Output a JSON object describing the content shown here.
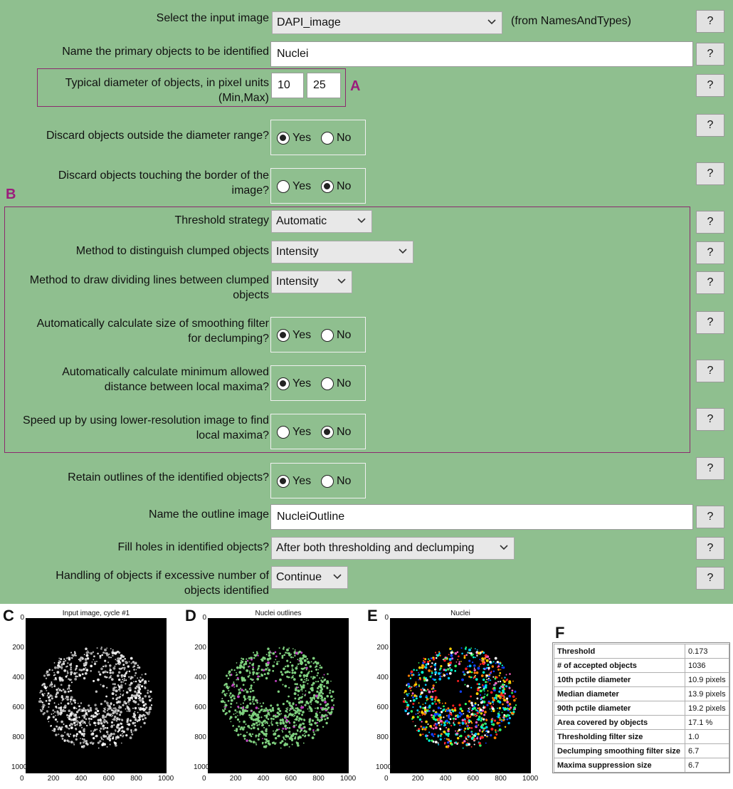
{
  "settings": {
    "input_image": {
      "label": "Select the input image",
      "value": "DAPI_image",
      "note": "(from NamesAndTypes)"
    },
    "primary_objects": {
      "label": "Name the primary objects to be identified",
      "value": "Nuclei"
    },
    "diameter": {
      "label_line1": "Typical diameter of objects, in pixel units",
      "label_line2": "(Min,Max)",
      "min": "10",
      "max": "25"
    },
    "discard_outside": {
      "label": "Discard objects outside the diameter range?"
    },
    "discard_border": {
      "label_line1": "Discard objects touching the border of the",
      "label_line2": "image?"
    },
    "threshold_strategy": {
      "label": "Threshold strategy",
      "value": "Automatic"
    },
    "clump_method": {
      "label": "Method to distinguish clumped objects",
      "value": "Intensity"
    },
    "dividing_lines": {
      "label_line1": "Method to draw dividing lines between clumped",
      "label_line2": "objects",
      "value": "Intensity"
    },
    "smoothing_filter": {
      "label_line1": "Automatically calculate size of smoothing filter",
      "label_line2": "for declumping?"
    },
    "min_distance": {
      "label_line1": "Automatically calculate minimum allowed",
      "label_line2": "distance between local maxima?"
    },
    "lower_res": {
      "label_line1": "Speed up by using lower-resolution image to find",
      "label_line2": "local maxima?"
    },
    "retain_outlines": {
      "label": "Retain outlines of the identified objects?"
    },
    "outline_name": {
      "label": "Name the outline image",
      "value": "NucleiOutline"
    },
    "fill_holes": {
      "label": "Fill holes in identified objects?",
      "value": "After both thresholding and declumping"
    },
    "excessive": {
      "label_line1": "Handling of objects if excessive number of",
      "label_line2": "objects identified",
      "value": "Continue"
    }
  },
  "radio": {
    "yes": "Yes",
    "no": "No"
  },
  "help_label": "?",
  "annotations": {
    "a": "A",
    "b": "B",
    "c": "C",
    "d": "D",
    "e": "E",
    "f": "F"
  },
  "plots": {
    "c_title": "Input image, cycle #1",
    "d_title": "Nuclei outlines",
    "e_title": "Nuclei",
    "x_ticks": [
      "0",
      "200",
      "400",
      "600",
      "800",
      "1000"
    ],
    "y_ticks": [
      "0",
      "200",
      "400",
      "600",
      "800",
      "1000"
    ]
  },
  "stats": [
    {
      "key": "Threshold",
      "value": "0.173"
    },
    {
      "key": "# of accepted objects",
      "value": "1036"
    },
    {
      "key": "10th pctile diameter",
      "value": "10.9 pixels"
    },
    {
      "key": "Median diameter",
      "value": "13.9 pixels"
    },
    {
      "key": "90th pctile diameter",
      "value": "19.2 pixels"
    },
    {
      "key": "Area covered by objects",
      "value": "17.1 %"
    },
    {
      "key": "Thresholding filter size",
      "value": "1.0"
    },
    {
      "key": "Declumping smoothing filter size",
      "value": "6.7"
    },
    {
      "key": "Maxima suppression size",
      "value": "6.7"
    }
  ],
  "colors": {
    "panel_bg": "#8fbf8f",
    "annotation": "#9b1c7c",
    "outline_green": "#7fd07f",
    "outline_magenta": "#c040c0"
  }
}
